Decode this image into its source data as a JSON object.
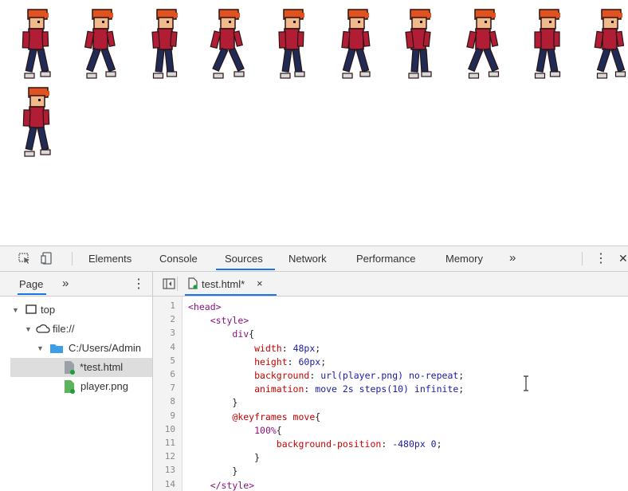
{
  "viewport": {
    "sprite_count": 11,
    "colors": {
      "hair": "#e2521f",
      "skin": "#f2b98a",
      "shirt": "#b01d35",
      "pants": "#1f2a55",
      "shoes": "#d9d9d9",
      "outline": "#2a1414"
    }
  },
  "devtools": {
    "toolbar": {
      "icons": [
        "inspect-element-icon",
        "device-toggle-icon"
      ],
      "tabs": [
        {
          "label": "Elements",
          "active": false
        },
        {
          "label": "Console",
          "active": false
        },
        {
          "label": "Sources",
          "active": true
        },
        {
          "label": "Network",
          "active": false
        },
        {
          "label": "Performance",
          "active": false
        },
        {
          "label": "Memory",
          "active": false
        }
      ],
      "more_tabs": "»",
      "menu_icon": "⋮",
      "close_icon": "✕",
      "accent": "#1a73e8"
    },
    "navigator": {
      "tab_label": "Page",
      "more": "»",
      "menu": "⋮",
      "tree": [
        {
          "label": "top",
          "icon": "frame-icon",
          "arrow": "▼"
        },
        {
          "label": "file://",
          "icon": "cloud-icon",
          "arrow": "▼"
        },
        {
          "label": "C:/Users/Admin",
          "icon": "folder-icon",
          "arrow": "▼"
        },
        {
          "label": "*test.html",
          "icon": "file-icon",
          "selected": true
        },
        {
          "label": "player.png",
          "icon": "file-icon",
          "selected": false
        }
      ]
    },
    "editor": {
      "toggle_icon": "sidebar-toggle-icon",
      "file_tab": "test.html*",
      "file_close": "×",
      "lines": [
        {
          "n": "1",
          "tokens": [
            {
              "t": "<head>",
              "c": "t-tag"
            }
          ]
        },
        {
          "n": "2",
          "tokens": [
            {
              "t": "    ",
              "c": "t-plain"
            },
            {
              "t": "<style>",
              "c": "t-tag"
            }
          ]
        },
        {
          "n": "3",
          "tokens": [
            {
              "t": "        ",
              "c": "t-plain"
            },
            {
              "t": "div",
              "c": "t-sel"
            },
            {
              "t": "{",
              "c": "t-plain"
            }
          ]
        },
        {
          "n": "4",
          "tokens": [
            {
              "t": "            ",
              "c": "t-plain"
            },
            {
              "t": "width",
              "c": "t-prop"
            },
            {
              "t": ": ",
              "c": "t-plain"
            },
            {
              "t": "48px",
              "c": "t-val"
            },
            {
              "t": ";",
              "c": "t-plain"
            }
          ]
        },
        {
          "n": "5",
          "tokens": [
            {
              "t": "            ",
              "c": "t-plain"
            },
            {
              "t": "height",
              "c": "t-prop"
            },
            {
              "t": ": ",
              "c": "t-plain"
            },
            {
              "t": "60px",
              "c": "t-val"
            },
            {
              "t": ";",
              "c": "t-plain"
            }
          ]
        },
        {
          "n": "6",
          "tokens": [
            {
              "t": "            ",
              "c": "t-plain"
            },
            {
              "t": "background",
              "c": "t-prop"
            },
            {
              "t": ": ",
              "c": "t-plain"
            },
            {
              "t": "url(player.png) no-repeat",
              "c": "t-val"
            },
            {
              "t": ";",
              "c": "t-plain"
            }
          ]
        },
        {
          "n": "7",
          "tokens": [
            {
              "t": "            ",
              "c": "t-plain"
            },
            {
              "t": "animation",
              "c": "t-prop"
            },
            {
              "t": ": ",
              "c": "t-plain"
            },
            {
              "t": "move 2s steps(10) infinite",
              "c": "t-val"
            },
            {
              "t": ";",
              "c": "t-plain"
            }
          ]
        },
        {
          "n": "8",
          "tokens": [
            {
              "t": "        }",
              "c": "t-plain"
            }
          ]
        },
        {
          "n": "9",
          "tokens": [
            {
              "t": "        ",
              "c": "t-plain"
            },
            {
              "t": "@keyframes move",
              "c": "t-kw"
            },
            {
              "t": "{",
              "c": "t-plain"
            }
          ]
        },
        {
          "n": "10",
          "tokens": [
            {
              "t": "            ",
              "c": "t-plain"
            },
            {
              "t": "100%",
              "c": "t-sel"
            },
            {
              "t": "{",
              "c": "t-plain"
            }
          ]
        },
        {
          "n": "11",
          "tokens": [
            {
              "t": "                ",
              "c": "t-plain"
            },
            {
              "t": "background-position",
              "c": "t-prop"
            },
            {
              "t": ": ",
              "c": "t-plain"
            },
            {
              "t": "-480px 0",
              "c": "t-val"
            },
            {
              "t": ";",
              "c": "t-plain"
            }
          ]
        },
        {
          "n": "12",
          "tokens": [
            {
              "t": "            }",
              "c": "t-plain"
            }
          ]
        },
        {
          "n": "13",
          "tokens": [
            {
              "t": "        }",
              "c": "t-plain"
            }
          ]
        },
        {
          "n": "14",
          "tokens": [
            {
              "t": "    ",
              "c": "t-plain"
            },
            {
              "t": "</style>",
              "c": "t-tag"
            }
          ]
        }
      ]
    }
  }
}
